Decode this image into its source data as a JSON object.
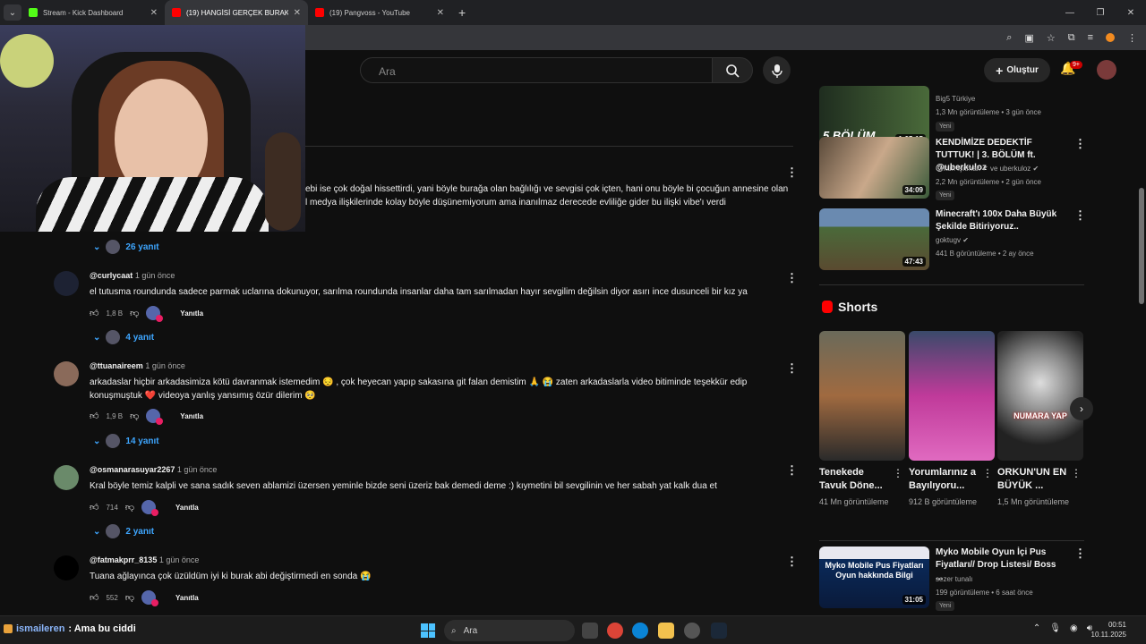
{
  "browser": {
    "tabs": [
      {
        "title": "Stream - Kick Dashboard",
        "favicon": "kick-icon",
        "color": "#53fc18"
      },
      {
        "title": "(19) HANGİSİ GERÇEK BURAK?",
        "favicon": "youtube-icon",
        "color": "#ff0000"
      },
      {
        "title": "(19) Pangvoss - YouTube",
        "favicon": "youtube-icon",
        "color": "#ff0000"
      }
    ],
    "new_tab": "+"
  },
  "header": {
    "search_placeholder": "Ara",
    "create_label": "Oluştur",
    "notif_count": "9+"
  },
  "pinned_comment_text": [
    "ebi ise çok doğal hissettirdi, yani böyle burağa olan bağlılığı ve sevgisi çok içten, hani onu böyle bi çocuğun annesine olan",
    "l medya ilişkilerinde kolay böyle düşünemiyorum ama inanılmaz derecede evliliğe gider bu ilişki vibe'ı verdi"
  ],
  "comments": [
    {
      "replies": "26 yanıt"
    },
    {
      "user": "@curlycaat",
      "time": "1 gün önce",
      "text": "el tutusma roundunda sadece parmak uclarına dokunuyor, sarılma roundunda insanlar daha tam sarılmadan hayır sevgilim değilsin diyor asırı ince dusunceli bir kız ya",
      "likes": "1,8 B",
      "reply_label": "Yanıtla",
      "replies": "4 yanıt"
    },
    {
      "user": "@ttuanaireem",
      "time": "1 gün önce",
      "text": "arkadaslar hiçbir arkadasimiza kötü davranmak istemedim 😔 , çok heyecan yapıp sakasına git falan demistim 🙏 😭 zaten arkadaslarla video bitiminde teşekkür edip konuşmuştuk ❤️ videoya yanlış yansımış özür dilerim 🥺",
      "likes": "1,9 B",
      "reply_label": "Yanıtla",
      "replies": "14 yanıt"
    },
    {
      "user": "@osmanarasuyar2267",
      "time": "1 gün önce",
      "text": "Kral böyle temiz kalpli ve sana sadık seven ablamizi üzersen yeminle bizde seni üzeriz bak demedi deme :) kıymetini bil sevgilinin ve her sabah yat kalk dua et",
      "likes": "714",
      "reply_label": "Yanıtla",
      "replies": "2 yanıt"
    },
    {
      "user": "@fatmakprr_8135",
      "time": "1 gün önce",
      "text": "Tuana ağlayınca çok üzüldüm iyi ki burak abi değiştirmedi en sonda 😭",
      "likes": "552",
      "reply_label": "Yanıtla"
    }
  ],
  "sidebar": {
    "videos": [
      {
        "title": "",
        "channel": "Big5 Türkiye",
        "meta": "1,3 Mn görüntüleme • 3 gün önce",
        "duration": "1:05:15",
        "badge": "Yeni",
        "thumb_text": "5.BÖLÜM"
      },
      {
        "title": "KENDİMİZE DEDEKTİF TUTTUK! | 3. BÖLÜM ft. @uberkuloz",
        "channel": "Orkun Işıtmak ✔ ve uberkuloz ✔",
        "meta": "2,2 Mn görüntüleme • 2 gün önce",
        "duration": "34:09",
        "badge": "Yeni"
      },
      {
        "title": "Minecraft'ı 100x Daha Büyük Şekilde Bitiriyoruz..",
        "channel": "goktugv ✔",
        "meta": "441 B görüntüleme • 2 ay önce",
        "duration": "47:43"
      },
      {
        "title": "Myko Mobile Oyun İçi Pus Fiyatları// Drop Listesi/ Boss ...",
        "channel": "sezer tunalı",
        "meta": "199 görüntüleme • 6 saat önce",
        "duration": "31:05",
        "badge": "Yeni",
        "thumb_text": "Myko Mobile Pus Fiyatları Oyun hakkında Bilgi"
      }
    ],
    "shorts_title": "Shorts",
    "shorts": [
      {
        "title": "Tenekede Tavuk Döne...",
        "views": "41 Mn görüntüleme"
      },
      {
        "title": "Yorumlarınız a Bayılıyoru...",
        "views": "912 B görüntüleme"
      },
      {
        "title": "ORKUN'UN EN BÜYÜK ...",
        "views": "1,5 Mn görüntüleme",
        "overlay": "NUMARA YAP"
      }
    ]
  },
  "chat": {
    "user": "ismaileren",
    "message": ": Ama bu ciddi"
  },
  "taskbar": {
    "search": "Ara",
    "time": "00:51",
    "date": "10.11.2025"
  }
}
